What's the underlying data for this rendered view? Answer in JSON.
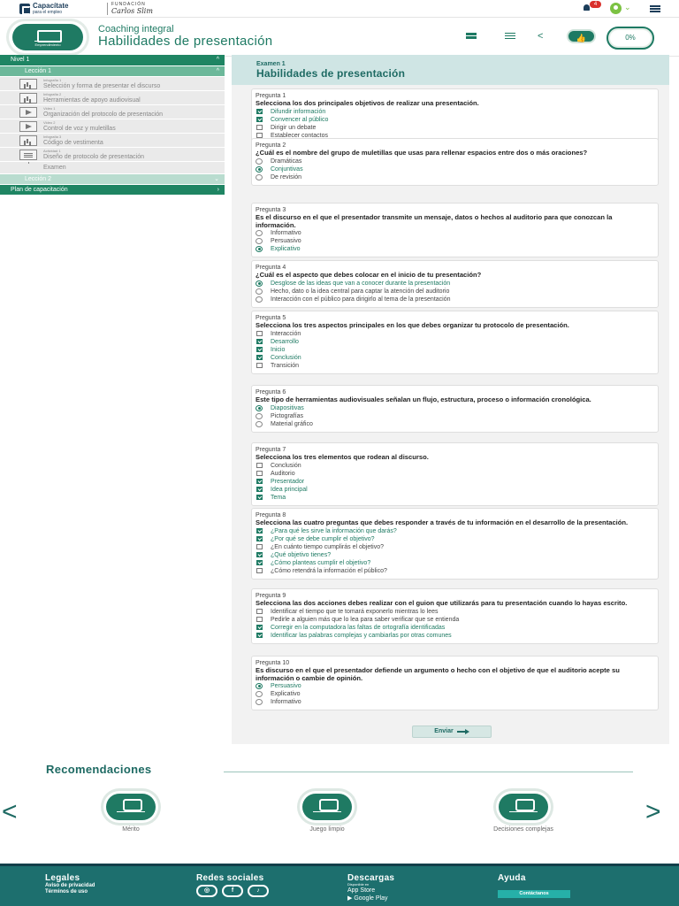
{
  "topbar": {
    "brand_main": "Capacítate",
    "brand_sub": "para el empleo",
    "foundation_label": "FUNDACIÓN",
    "foundation_name": "Carlos Slim",
    "notifications_count": "4"
  },
  "header": {
    "badge_label": "Emprendimiento",
    "subtitle": "Coaching integral",
    "title": "Habilidades de presentación",
    "progress": "0%"
  },
  "sidebar": {
    "level1": "Nivel 1",
    "lesson1": "Lección 1",
    "items": [
      {
        "kind": "Infografía 1",
        "name": "Selección y forma de presentar el discurso"
      },
      {
        "kind": "Infografía 2",
        "name": "Herramientas de apoyo audiovisual"
      },
      {
        "kind": "Video 1",
        "name": "Organización del protocolo de presentación"
      },
      {
        "kind": "Video 2",
        "name": "Control de voz y muletillas"
      },
      {
        "kind": "Infografía 3",
        "name": "Código de vestimenta"
      },
      {
        "kind": "Actividad 1",
        "name": "Diseño de protocolo de presentación"
      }
    ],
    "exam": "Examen",
    "lesson2": "Lección 2",
    "plan": "Plan de capacitación"
  },
  "exam": {
    "subtitle": "Examen 1",
    "title": "Habilidades de presentación",
    "send": "Enviar",
    "questions": [
      {
        "num": "Pregunta 1",
        "text": "Selecciona los dos principales objetivos de realizar una presentación.",
        "type": "checkbox",
        "options": [
          {
            "label": "Difundir información",
            "on": true
          },
          {
            "label": "Convencer al público",
            "on": true
          },
          {
            "label": "Dirigir un debate",
            "on": false
          },
          {
            "label": "Establecer contactos",
            "on": false
          }
        ]
      },
      {
        "num": "Pregunta 2",
        "text": "¿Cuál es el nombre del grupo de muletillas que usas para rellenar espacios entre dos o más oraciones?",
        "type": "radio",
        "options": [
          {
            "label": "Dramáticas",
            "on": false
          },
          {
            "label": "Conjuntivas",
            "on": true
          },
          {
            "label": "De revisión",
            "on": false
          }
        ]
      },
      {
        "num": "Pregunta 3",
        "text": "Es el discurso en el que el presentador transmite un mensaje, datos o hechos al auditorio para que conozcan la información.",
        "type": "radio",
        "options": [
          {
            "label": "Informativo",
            "on": false
          },
          {
            "label": "Persuasivo",
            "on": false
          },
          {
            "label": "Explicativo",
            "on": true
          }
        ]
      },
      {
        "num": "Pregunta 4",
        "text": "¿Cuál es el aspecto que debes colocar en el inicio de tu presentación?",
        "type": "radio",
        "options": [
          {
            "label": "Desglose de las ideas que van a conocer durante la presentación",
            "on": true
          },
          {
            "label": "Hecho, dato o la idea central para captar la atención del auditorio",
            "on": false
          },
          {
            "label": "Interacción con el público para dirigirlo al tema de la presentación",
            "on": false
          }
        ]
      },
      {
        "num": "Pregunta 5",
        "text": "Selecciona los tres aspectos principales en los que debes organizar tu protocolo de presentación.",
        "type": "checkbox",
        "options": [
          {
            "label": "Interacción",
            "on": false
          },
          {
            "label": "Desarrollo",
            "on": true
          },
          {
            "label": "Inicio",
            "on": true
          },
          {
            "label": "Conclusión",
            "on": true
          },
          {
            "label": "Transición",
            "on": false
          }
        ]
      },
      {
        "num": "Pregunta 6",
        "text": "Este tipo de herramientas audiovisuales señalan un flujo, estructura, proceso o información cronológica.",
        "type": "radio",
        "options": [
          {
            "label": "Diapositivas",
            "on": true
          },
          {
            "label": "Pictografías",
            "on": false
          },
          {
            "label": "Material gráfico",
            "on": false
          }
        ]
      },
      {
        "num": "Pregunta 7",
        "text": "Selecciona los tres elementos que rodean al discurso.",
        "type": "checkbox",
        "options": [
          {
            "label": "Conclusión",
            "on": false
          },
          {
            "label": "Auditorio",
            "on": false
          },
          {
            "label": "Presentador",
            "on": true
          },
          {
            "label": "Idea principal",
            "on": true
          },
          {
            "label": "Tema",
            "on": true
          }
        ]
      },
      {
        "num": "Pregunta 8",
        "text": "Selecciona las cuatro preguntas que debes responder a través de tu información en el desarrollo de la presentación.",
        "type": "checkbox",
        "options": [
          {
            "label": "¿Para qué les sirve la información que darás?",
            "on": true
          },
          {
            "label": "¿Por qué se debe cumplir el objetivo?",
            "on": true
          },
          {
            "label": "¿En cuánto tiempo cumplirás el objetivo?",
            "on": false
          },
          {
            "label": "¿Qué objetivo tienes?",
            "on": true
          },
          {
            "label": "¿Cómo planteas cumplir el objetivo?",
            "on": true
          },
          {
            "label": "¿Cómo retendrá la información el público?",
            "on": false
          }
        ]
      },
      {
        "num": "Pregunta 9",
        "text": "Selecciona las dos acciones debes realizar con el guion que utilizarás para tu presentación cuando lo hayas escrito.",
        "type": "checkbox",
        "options": [
          {
            "label": "Identificar el tiempo que te tomará exponerlo mientras lo lees",
            "on": false
          },
          {
            "label": "Pedirle a alguien más que lo lea para saber verificar que se entienda",
            "on": false
          },
          {
            "label": "Corregir en la computadora las faltas de ortografía identificadas",
            "on": true
          },
          {
            "label": "Identificar las palabras complejas y cambiarlas por otras comunes",
            "on": true
          }
        ]
      },
      {
        "num": "Pregunta 10",
        "text": "Es discurso en el que el presentador defiende un argumento o hecho con el objetivo de que el auditorio acepte su información o cambie de opinión.",
        "type": "radio",
        "options": [
          {
            "label": "Persuasivo",
            "on": true
          },
          {
            "label": "Explicativo",
            "on": false
          },
          {
            "label": "Informativo",
            "on": false
          }
        ]
      }
    ]
  },
  "recommendations": {
    "title": "Recomendaciones",
    "items": [
      {
        "label": "Mérito",
        "badge": "Valores"
      },
      {
        "label": "Juego limpio",
        "badge": "Valores"
      },
      {
        "label": "Decisiones complejas",
        "badge": "Valores"
      }
    ]
  },
  "footer": {
    "legal_title": "Legales",
    "privacy": "Aviso de privacidad",
    "terms": "Términos de uso",
    "social_title": "Redes sociales",
    "downloads_title": "Descargas",
    "appstore_small": "Disponible en",
    "appstore": "App Store",
    "googleplay": "Google Play",
    "help_title": "Ayuda",
    "contact": "Contáctanos"
  },
  "colors": {
    "primary": "#1e7a63",
    "footer": "#1d6f6e",
    "exam_header": "#cfe5e4"
  }
}
